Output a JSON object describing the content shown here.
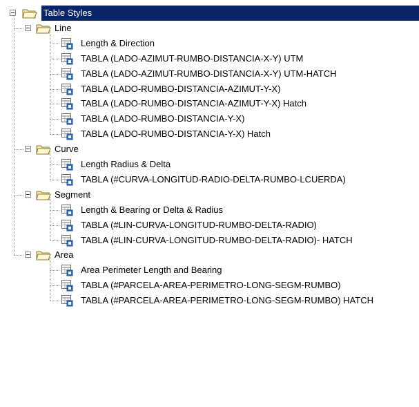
{
  "root": {
    "label": "Table Styles",
    "icon": "open-folder-icon"
  },
  "groups": [
    {
      "label": "Line",
      "items": [
        "Length & Direction",
        "TABLA (LADO-AZIMUT-RUMBO-DISTANCIA-X-Y) UTM",
        "TABLA (LADO-AZIMUT-RUMBO-DISTANCIA-X-Y) UTM-HATCH",
        "TABLA (LADO-RUMBO-DISTANCIA-AZIMUT-Y-X)",
        "TABLA (LADO-RUMBO-DISTANCIA-AZIMUT-Y-X) Hatch",
        "TABLA (LADO-RUMBO-DISTANCIA-Y-X)",
        "TABLA (LADO-RUMBO-DISTANCIA-Y-X) Hatch"
      ]
    },
    {
      "label": "Curve",
      "items": [
        "Length Radius & Delta",
        "TABLA (#CURVA-LONGITUD-RADIO-DELTA-RUMBO-LCUERDA)"
      ]
    },
    {
      "label": "Segment",
      "items": [
        "Length & Bearing or Delta & Radius",
        "TABLA (#LIN-CURVA-LONGITUD-RUMBO-DELTA-RADIO)",
        "TABLA (#LIN-CURVA-LONGITUD-RUMBO-DELTA-RADIO)- HATCH"
      ]
    },
    {
      "label": "Area",
      "items": [
        "Area Perimeter Length and Bearing",
        "TABLA (#PARCELA-AREA-PERIMETRO-LONG-SEGM-RUMBO)",
        "TABLA (#PARCELA-AREA-PERIMETRO-LONG-SEGM-RUMBO) HATCH"
      ]
    }
  ],
  "colors": {
    "selection": "#0a246a",
    "folder_fill": "#f5e6a8",
    "folder_stroke": "#8a7a3a",
    "doc_blue": "#2f73c8",
    "connector": "#9a9a9a"
  }
}
